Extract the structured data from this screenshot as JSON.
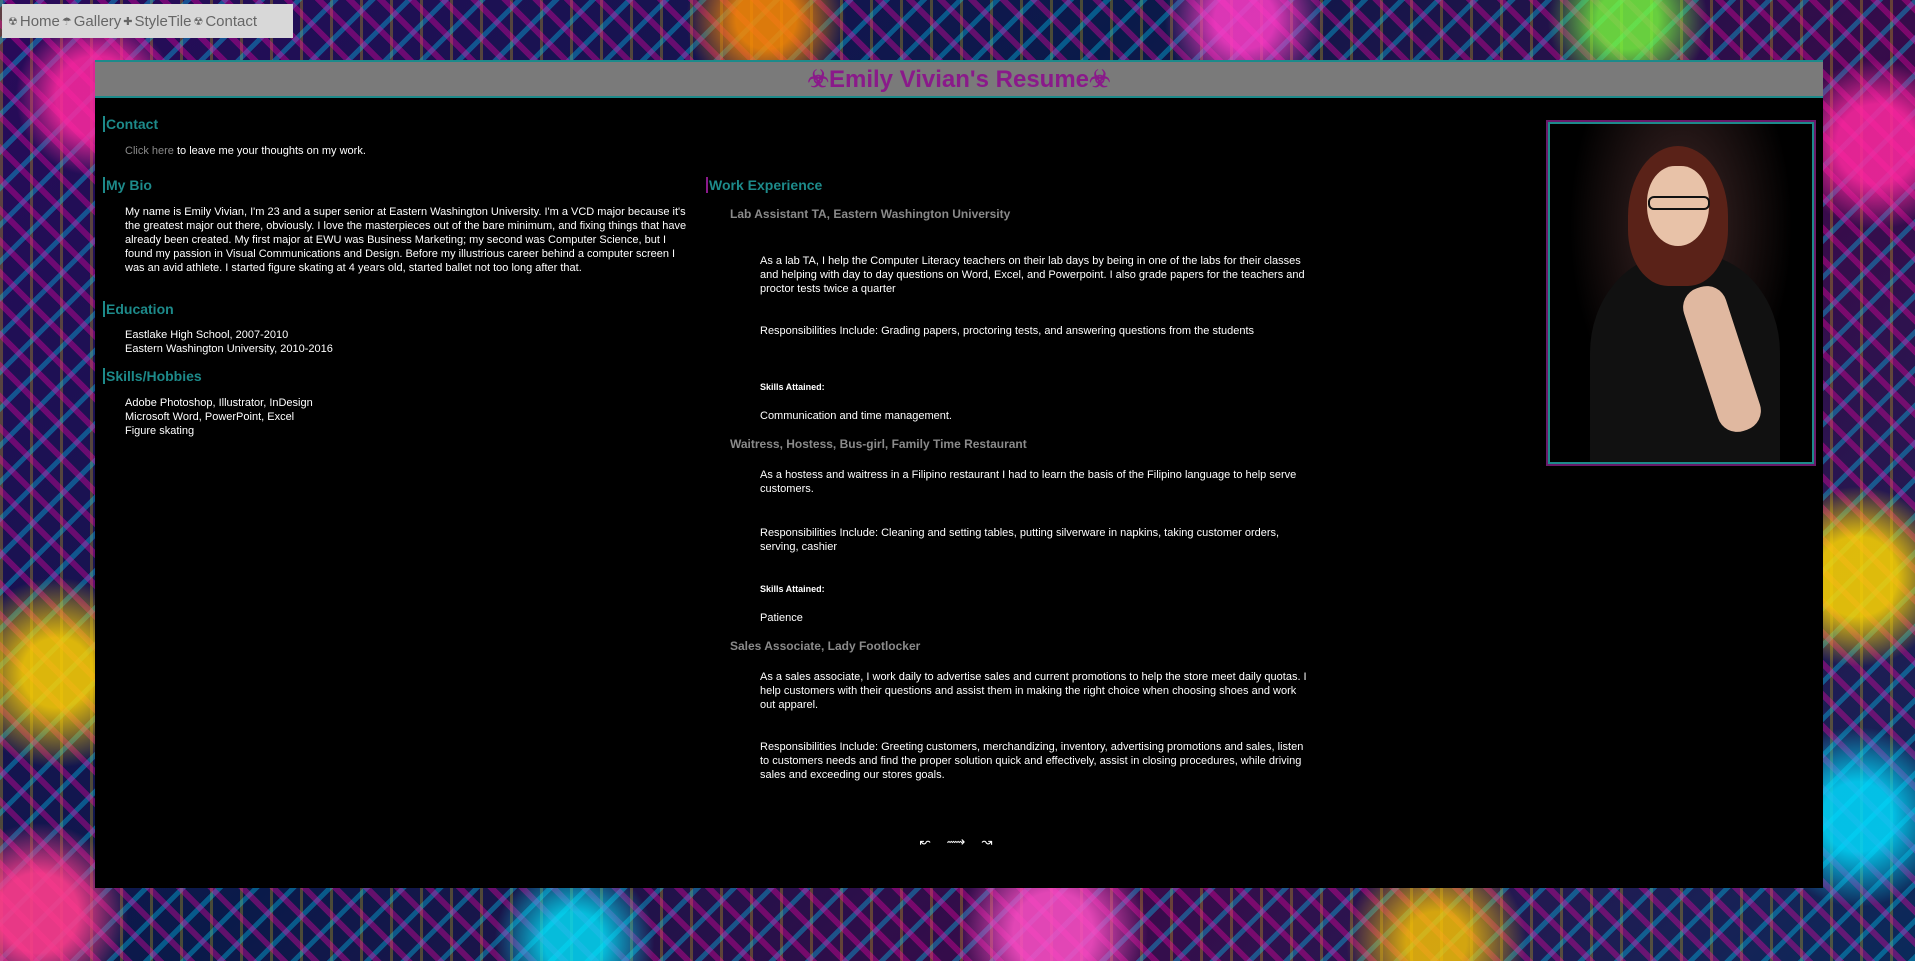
{
  "nav": {
    "items": [
      {
        "icon": "☢",
        "label": "Home"
      },
      {
        "icon": "☂",
        "label": "Gallery"
      },
      {
        "icon": "✚",
        "label": "StyleTile"
      },
      {
        "icon": "☢",
        "label": "Contact"
      }
    ]
  },
  "header": {
    "title": "☣Emily Vivian's Resume☣"
  },
  "contact": {
    "title": "Contact",
    "link": "Click here",
    "text": " to leave me your thoughts on my work."
  },
  "bio": {
    "title": "My Bio",
    "text": "My name is Emily Vivian, I'm 23 and a super senior at Eastern Washington University. I'm a VCD major because it's the greatest major out there, obviously. I love the masterpieces out of the bare minimum, and fixing things that have already been created. My first major at EWU was Business Marketing; my second was Computer Science, but I found my passion in Visual Communications and Design. Before my illustrious career behind a computer screen I was an avid athlete. I started figure skating at 4 years old, started ballet not too long after that."
  },
  "education": {
    "title": "Education",
    "items": [
      "Eastlake High School, 2007-2010",
      "Eastern Washington University, 2010-2016"
    ]
  },
  "skills": {
    "title": "Skills/Hobbies",
    "items": [
      "Adobe Photoshop, Illustrator, InDesign",
      "Microsoft Word, PowerPoint, Excel",
      "Figure skating"
    ]
  },
  "work": {
    "title": "Work Experience",
    "jobs": [
      {
        "title": "Lab Assistant TA, Eastern Washington University",
        "description": "As a lab TA, I help the Computer Literacy teachers on their lab days by being in one of the labs for their classes and helping with day to day questions on Word, Excel, and Powerpoint. I also grade papers for the teachers and proctor tests twice a quarter",
        "responsibilities": "Responsibilities Include: Grading papers, proctoring tests, and answering questions from the students",
        "skills_label": "Skills Attained:",
        "skills": "Communication and time management."
      },
      {
        "title": "Waitress, Hostess, Bus-girl, Family Time Restaurant",
        "description": "As a hostess and waitress in a Filipino restaurant I had to learn the basis of the Filipino language to help serve customers.",
        "responsibilities": "Responsibilities Include: Cleaning and setting tables, putting silverware in napkins, taking customer orders, serving, cashier",
        "skills_label": "Skills Attained:",
        "skills": "Patience"
      },
      {
        "title": "Sales Associate, Lady Footlocker",
        "description": "As a sales associate, I work daily to advertise sales and current promotions to help the store meet daily quotas. I help customers with their questions and assist them in making the right choice when choosing shoes and work out apparel.",
        "responsibilities": "Responsibilities Include: Greeting customers, merchandizing, inventory, advertising promotions and sales, listen to customers needs and find the proper solution quick and effectively, assist in closing procedures, while driving sales and exceeding our stores goals."
      }
    ]
  },
  "footer": {
    "decoration": "↜ ⟿ ↝"
  },
  "colors": {
    "accent_teal": "#1d8a8a",
    "accent_purple": "#8a1a8a"
  }
}
